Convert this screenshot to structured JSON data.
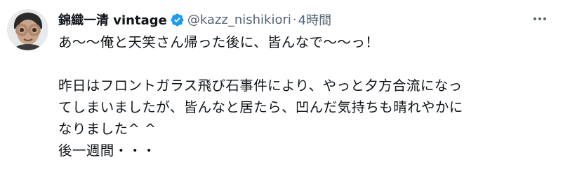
{
  "tweet": {
    "author": {
      "display_name": "錦織一清 vintage",
      "handle": "@kazz_nishikiori",
      "verified": true,
      "avatar": "avatar-photo"
    },
    "separator": "·",
    "time": "4時間",
    "more_icon": "more-dots-icon",
    "lines": [
      "あ～～俺と天笑さん帰った後に、皆んなで～～っ！",
      "",
      "昨日はフロントガラス飛び石事件により、やっと夕方合流になっ",
      "てしまいましたが、皆んなと居たら、凹んだ気持ちも晴れやかに",
      "なりました^ ^",
      "後一週間・・・"
    ]
  },
  "colors": {
    "text": "#0f1419",
    "secondary": "#536471",
    "verified": "#1d9bf0"
  }
}
